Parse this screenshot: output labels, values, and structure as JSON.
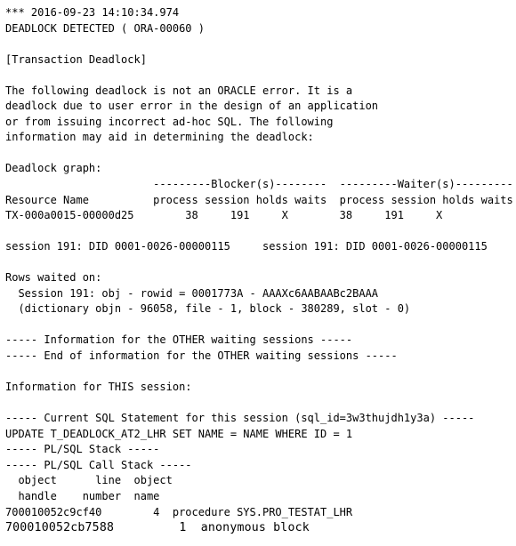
{
  "document": {
    "kind": "oracle-trace-file",
    "background_color": "#ffffff",
    "text_color": "#000000",
    "lines": [
      {
        "id": "timestamp",
        "text": "*** 2016-09-23 14:10:34.974"
      },
      {
        "id": "deadlock-detected",
        "text": "DEADLOCK DETECTED ( ORA-00060 )"
      },
      {
        "id": "blank-1",
        "text": ""
      },
      {
        "id": "transaction-deadlock-header",
        "text": "[Transaction Deadlock]"
      },
      {
        "id": "blank-2",
        "text": ""
      },
      {
        "id": "description-1",
        "text": "The following deadlock is not an ORACLE error. It is a"
      },
      {
        "id": "description-2",
        "text": "deadlock due to user error in the design of an application"
      },
      {
        "id": "description-3",
        "text": "or from issuing incorrect ad-hoc SQL. The following"
      },
      {
        "id": "description-4",
        "text": "information may aid in determining the deadlock:"
      },
      {
        "id": "blank-3",
        "text": ""
      },
      {
        "id": "deadlock-graph-label",
        "text": "Deadlock graph:"
      },
      {
        "id": "graph-rule-row",
        "text": "                       ---------Blocker(s)--------  ---------Waiter(s)---------"
      },
      {
        "id": "graph-column-headers",
        "text": "Resource Name          process session holds waits  process session holds waits"
      },
      {
        "id": "graph-row-tx",
        "text": "TX-000a0015-00000d25        38     191     X        38     191     X"
      },
      {
        "id": "blank-4",
        "text": ""
      },
      {
        "id": "session-did-line",
        "text": "session 191: DID 0001-0026-00000115     session 191: DID 0001-0026-00000115"
      },
      {
        "id": "blank-5",
        "text": ""
      },
      {
        "id": "rows-waited-on-label",
        "text": "Rows waited on:"
      },
      {
        "id": "rows-waited-session",
        "text": "  Session 191: obj - rowid = 0001773A - AAAXc6AABAABc2BAAA"
      },
      {
        "id": "rows-waited-dictionary",
        "text": "  (dictionary objn - 96058, file - 1, block - 380289, slot - 0)"
      },
      {
        "id": "blank-6",
        "text": ""
      },
      {
        "id": "other-sessions-start",
        "text": "----- Information for the OTHER waiting sessions -----"
      },
      {
        "id": "other-sessions-end",
        "text": "----- End of information for the OTHER waiting sessions -----"
      },
      {
        "id": "blank-7",
        "text": ""
      },
      {
        "id": "this-session-label",
        "text": "Information for THIS session:"
      },
      {
        "id": "blank-8",
        "text": ""
      },
      {
        "id": "current-sql-header",
        "text": "----- Current SQL Statement for this session (sql_id=3w3thujdh1y3a) -----"
      },
      {
        "id": "current-sql-statement",
        "text": "UPDATE T_DEADLOCK_AT2_LHR SET NAME = NAME WHERE ID = 1"
      },
      {
        "id": "plsql-stack-header",
        "text": "----- PL/SQL Stack -----"
      },
      {
        "id": "plsql-call-stack-header",
        "text": "----- PL/SQL Call Stack -----"
      },
      {
        "id": "call-stack-col-1",
        "text": "  object      line  object"
      },
      {
        "id": "call-stack-col-2",
        "text": "  handle    number  name"
      },
      {
        "id": "call-stack-row-1",
        "text": "700010052c9cf40        4  procedure SYS.PRO_TESTAT_LHR"
      },
      {
        "id": "call-stack-row-2",
        "text": "700010052cb7588         1  anonymous block",
        "alt": true
      }
    ]
  },
  "details": {
    "timestamp": "2016-09-23 14:10:34.974",
    "error_code": "ORA-00060",
    "deadlock_type": "[Transaction Deadlock]",
    "resource_name": "TX-000a0015-00000d25",
    "blocker": {
      "process": "38",
      "session": "191",
      "holds": "X",
      "waits": ""
    },
    "waiter": {
      "process": "38",
      "session": "191",
      "holds": "",
      "waits": "X"
    },
    "session_id": "191",
    "did": "0001-0026-00000115",
    "rowid_obj": "0001773A",
    "rowid": "AAAXc6AABAABc2BAAA",
    "dictionary_objn": "96058",
    "file": "1",
    "block": "380289",
    "slot": "0",
    "sql_id": "3w3thujdh1y3a",
    "sql_statement": "UPDATE T_DEADLOCK_AT2_LHR SET NAME = NAME WHERE ID = 1",
    "call_stack": [
      {
        "handle": "700010052c9cf40",
        "line_number": "4",
        "object_name": "procedure SYS.PRO_TESTAT_LHR"
      },
      {
        "handle": "700010052cb7588",
        "line_number": "1",
        "object_name": "anonymous block"
      }
    ]
  }
}
